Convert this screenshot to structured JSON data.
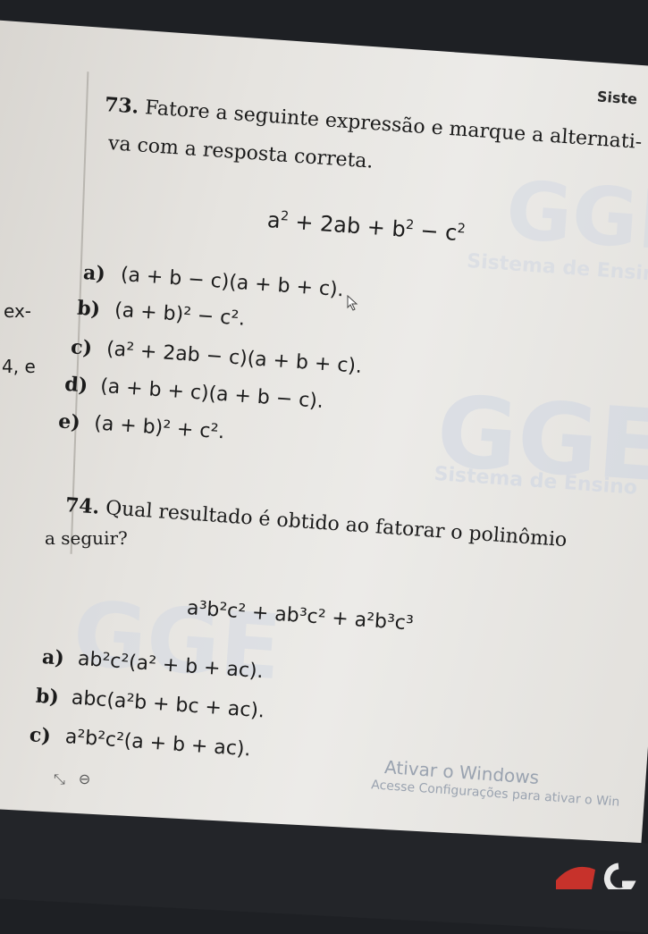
{
  "header": {
    "tag": "Siste"
  },
  "q73": {
    "number": "73.",
    "line1": "Fatore a seguinte expressão e marque a alternati-",
    "line2": "va com a resposta correta.",
    "expression": {
      "a": "a",
      "p1": "2",
      "mid": "+ 2ab + b",
      "p2": "2",
      "end": "− c",
      "p3": "2"
    },
    "options": [
      {
        "letter": "a)",
        "expr": "(a + b − c)(a + b + c)."
      },
      {
        "letter": "b)",
        "expr": "(a + b)² − c²."
      },
      {
        "letter": "c)",
        "expr": "(a² + 2ab − c)(a + b + c)."
      },
      {
        "letter": "d)",
        "expr": "(a + b + c)(a + b − c)."
      },
      {
        "letter": "e)",
        "expr": "(a + b)² + c²."
      }
    ]
  },
  "q74": {
    "number": "74.",
    "line1": "Qual resultado é obtido ao fatorar o polinômio",
    "line2": "a seguir?",
    "expression": "a³b²c² + ab³c² + a²b³c³",
    "options": [
      {
        "letter": "a)",
        "expr": "ab²c²(a² + b + ac)."
      },
      {
        "letter": "b)",
        "expr": "abc(a²b + bc + ac)."
      },
      {
        "letter": "c)",
        "expr": "a²b²c²(a + b + ac)."
      }
    ]
  },
  "side_text": {
    "t1": "ex-",
    "t2": "4, e"
  },
  "watermarks": [
    "GGE",
    "Sistema de Ensino"
  ],
  "windows": {
    "title": "Ativar o Windows",
    "subtitle": "Acesse Configurações para ativar o Win"
  }
}
